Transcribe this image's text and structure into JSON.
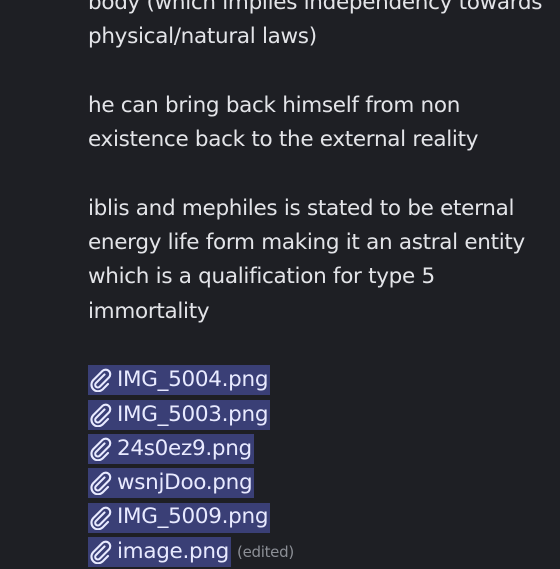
{
  "message": {
    "paragraphs": [
      "body (which implies independency towards physical/natural laws)",
      "he can bring back himself from non existence back to the external reality",
      "iblis and mephiles is stated to be eternal energy life form making it an astral entity which is a qualification for type 5 immortality"
    ],
    "attachments": [
      {
        "name": "IMG_5004.png",
        "icon": "paperclip-icon"
      },
      {
        "name": "IMG_5003.png",
        "icon": "paperclip-icon"
      },
      {
        "name": "24s0ez9.png",
        "icon": "paperclip-icon"
      },
      {
        "name": "wsnjDoo.png",
        "icon": "paperclip-icon"
      },
      {
        "name": "IMG_5009.png",
        "icon": "paperclip-icon"
      },
      {
        "name": "image.png",
        "icon": "paperclip-icon"
      }
    ],
    "edited_label": "(edited)"
  },
  "colors": {
    "background": "#1e1f24",
    "text": "#e3e4e8",
    "selection": "#3a3f76",
    "muted": "#8c8f96"
  }
}
